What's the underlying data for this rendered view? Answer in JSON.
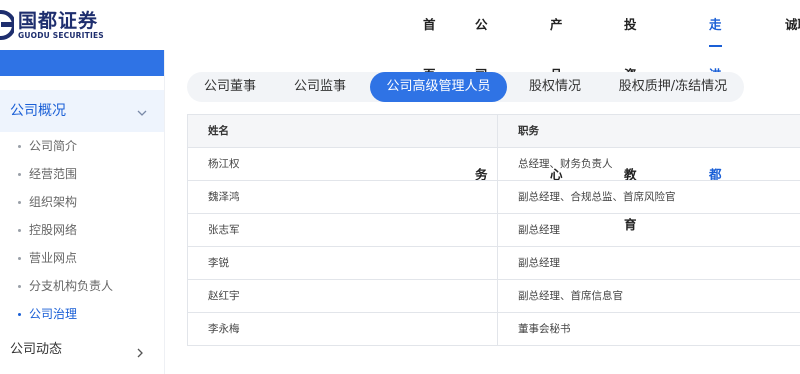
{
  "header": {
    "logo_cn": "国都证券",
    "logo_en": "GUODU SECURITIES",
    "nav": [
      {
        "label": "首页"
      },
      {
        "label": "公司业务"
      },
      {
        "label": "产品中心"
      },
      {
        "label": "投资者教育"
      },
      {
        "label": "走进国都",
        "active": true
      },
      {
        "label": "诚聘"
      }
    ]
  },
  "sidebar": {
    "section": "公司概况",
    "items": [
      {
        "label": "公司简介"
      },
      {
        "label": "经营范围"
      },
      {
        "label": "组织架构"
      },
      {
        "label": "控股网络"
      },
      {
        "label": "营业网点"
      },
      {
        "label": "分支机构负责人"
      },
      {
        "label": "公司治理",
        "active": true
      }
    ],
    "section2": "公司动态"
  },
  "tabs": [
    {
      "label": "公司董事"
    },
    {
      "label": "公司监事"
    },
    {
      "label": "公司高级管理人员",
      "active": true
    },
    {
      "label": "股权情况"
    },
    {
      "label": "股权质押/冻结情况"
    }
  ],
  "table": {
    "headers": [
      "姓名",
      "职务"
    ],
    "rows": [
      [
        "杨江权",
        "总经理、财务负责人"
      ],
      [
        "魏泽鸿",
        "副总经理、合规总监、首席风险官"
      ],
      [
        "张志军",
        "副总经理"
      ],
      [
        "李锐",
        "副总经理"
      ],
      [
        "赵红宇",
        "副总经理、首席信息官"
      ],
      [
        "李永梅",
        "董事会秘书"
      ]
    ]
  },
  "colors": {
    "accent": "#2f73e5",
    "brand": "#1e2e6e",
    "active_text": "#1a5fd6"
  }
}
